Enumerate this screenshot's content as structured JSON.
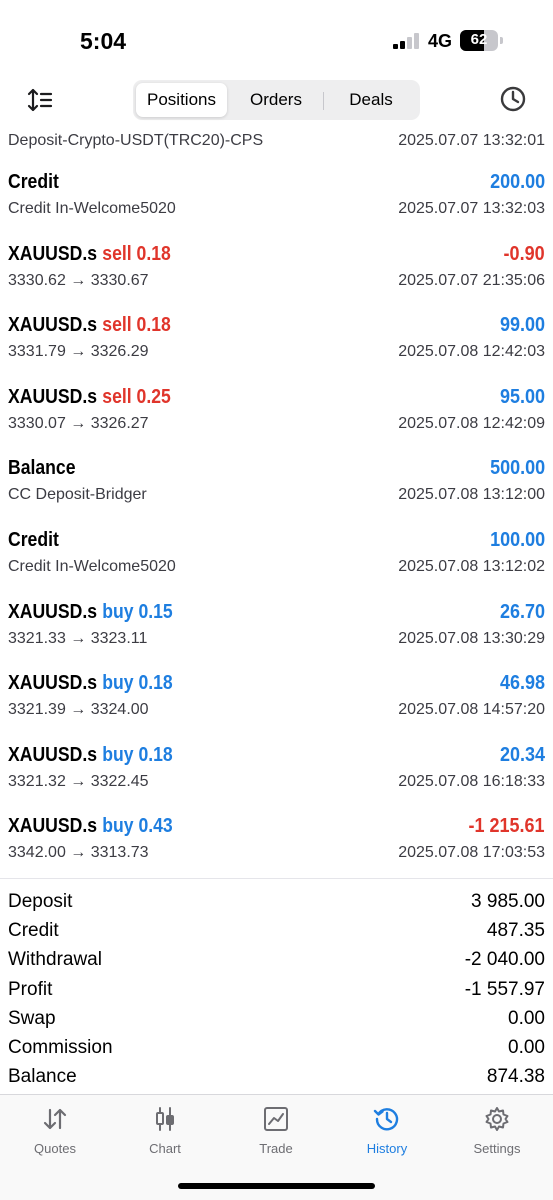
{
  "status_bar": {
    "time": "5:04",
    "network": "4G",
    "battery": "62"
  },
  "toolbar": {
    "tabs": [
      {
        "label": "Positions",
        "active": true
      },
      {
        "label": "Orders",
        "active": false
      },
      {
        "label": "Deals",
        "active": false
      }
    ]
  },
  "history": [
    {
      "title": "",
      "side": "",
      "amount": "",
      "amount_sign": "",
      "detail": "Deposit-Crypto-USDT(TRC20)-CPS",
      "time": "2025.07.07 13:32:01"
    },
    {
      "title": "Credit",
      "side": "",
      "amount": "200.00",
      "amount_sign": "pos",
      "detail": "Credit In-Welcome5020",
      "time": "2025.07.07 13:32:03"
    },
    {
      "title": "XAUUSD.s",
      "side": "sell 0.18",
      "side_type": "sell",
      "amount": "-0.90",
      "amount_sign": "neg",
      "detail": "3330.62 → 3330.67",
      "time": "2025.07.07 21:35:06"
    },
    {
      "title": "XAUUSD.s",
      "side": "sell 0.18",
      "side_type": "sell",
      "amount": "99.00",
      "amount_sign": "pos",
      "detail": "3331.79 → 3326.29",
      "time": "2025.07.08 12:42:03"
    },
    {
      "title": "XAUUSD.s",
      "side": "sell 0.25",
      "side_type": "sell",
      "amount": "95.00",
      "amount_sign": "pos",
      "detail": "3330.07 → 3326.27",
      "time": "2025.07.08 12:42:09"
    },
    {
      "title": "Balance",
      "side": "",
      "amount": "500.00",
      "amount_sign": "pos",
      "detail": "CC Deposit-Bridger",
      "time": "2025.07.08 13:12:00"
    },
    {
      "title": "Credit",
      "side": "",
      "amount": "100.00",
      "amount_sign": "pos",
      "detail": "Credit In-Welcome5020",
      "time": "2025.07.08 13:12:02"
    },
    {
      "title": "XAUUSD.s",
      "side": "buy 0.15",
      "side_type": "buy",
      "amount": "26.70",
      "amount_sign": "pos",
      "detail": "3321.33 → 3323.11",
      "time": "2025.07.08 13:30:29"
    },
    {
      "title": "XAUUSD.s",
      "side": "buy 0.18",
      "side_type": "buy",
      "amount": "46.98",
      "amount_sign": "pos",
      "detail": "3321.39 → 3324.00",
      "time": "2025.07.08 14:57:20"
    },
    {
      "title": "XAUUSD.s",
      "side": "buy 0.18",
      "side_type": "buy",
      "amount": "20.34",
      "amount_sign": "pos",
      "detail": "3321.32 → 3322.45",
      "time": "2025.07.08 16:18:33"
    },
    {
      "title": "XAUUSD.s",
      "side": "buy 0.43",
      "side_type": "buy",
      "amount": "-1 215.61",
      "amount_sign": "neg",
      "detail": "3342.00 → 3313.73",
      "time": "2025.07.08 17:03:53"
    }
  ],
  "summary": [
    {
      "label": "Deposit",
      "value": "3 985.00"
    },
    {
      "label": "Credit",
      "value": "487.35"
    },
    {
      "label": "Withdrawal",
      "value": "-2 040.00"
    },
    {
      "label": "Profit",
      "value": "-1 557.97"
    },
    {
      "label": "Swap",
      "value": "0.00"
    },
    {
      "label": "Commission",
      "value": "0.00"
    },
    {
      "label": "Balance",
      "value": "874.38"
    }
  ],
  "tabbar": {
    "items": [
      {
        "label": "Quotes",
        "icon": "quotes-arrows-icon",
        "active": false
      },
      {
        "label": "Chart",
        "icon": "candlestick-chart-icon",
        "active": false
      },
      {
        "label": "Trade",
        "icon": "trade-chart-icon",
        "active": false
      },
      {
        "label": "History",
        "icon": "history-clock-icon",
        "active": true
      },
      {
        "label": "Settings",
        "icon": "gear-icon",
        "active": false
      }
    ]
  },
  "colors": {
    "accent": "#1e7ee0",
    "negative": "#e0352b"
  }
}
